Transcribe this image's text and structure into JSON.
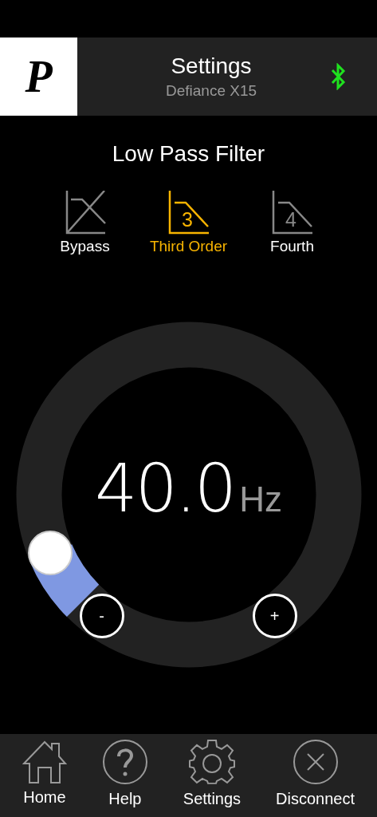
{
  "header": {
    "logo": "P",
    "title": "Settings",
    "subtitle": "Defiance X15",
    "bluetooth_connected": true
  },
  "section_title": "Low Pass Filter",
  "filter_options": [
    {
      "label": "Bypass",
      "kind": "bypass",
      "selected": false
    },
    {
      "label": "Third Order",
      "kind": "order",
      "badge": "3",
      "selected": true
    },
    {
      "label": "Fourth",
      "kind": "order",
      "badge": "4",
      "selected": false
    }
  ],
  "dial": {
    "value": "40.0",
    "unit": "Hz",
    "minus": "-",
    "plus": "+"
  },
  "nav": [
    {
      "label": "Home",
      "kind": "home"
    },
    {
      "label": "Help",
      "kind": "help"
    },
    {
      "label": "Settings",
      "kind": "settings"
    },
    {
      "label": "Disconnect",
      "kind": "disconnect"
    }
  ]
}
